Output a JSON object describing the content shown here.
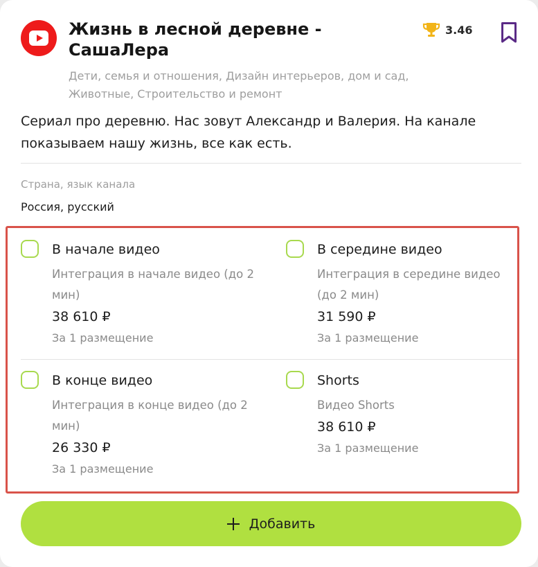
{
  "channel": {
    "platform_icon": "youtube-icon",
    "title": "Жизнь в лесной деревне - СашаЛера",
    "rating": "3.46",
    "rating_icon": "trophy-icon",
    "bookmark_icon": "bookmark-icon",
    "categories": "Дети, семья и отношения, Дизайн интерьеров, дом и сад, Животные, Строительство и ремонт",
    "description": "Сериал про деревню. Нас зовут Александр и Валерия. На канале показываем нашу жизнь, все как есть."
  },
  "meta": {
    "label": "Страна, язык канала",
    "value": "Россия, русский"
  },
  "options": [
    {
      "title": "В начале видео",
      "description": "Интеграция в начале видео (до 2 мин)",
      "price": "38 610 ₽",
      "unit": "За 1 размещение",
      "checked": false
    },
    {
      "title": "В середине видео",
      "description": "Интеграция в середине видео (до 2 мин)",
      "price": "31 590 ₽",
      "unit": "За 1 размещение",
      "checked": false
    },
    {
      "title": "В конце видео",
      "description": "Интеграция в конце видео (до 2 мин)",
      "price": "26 330 ₽",
      "unit": "За 1 размещение",
      "checked": false
    },
    {
      "title": "Shorts",
      "description": "Видео Shorts",
      "price": "38 610 ₽",
      "unit": "За 1 размещение",
      "checked": false
    }
  ],
  "add_button": {
    "icon": "plus-icon",
    "label": "Добавить"
  },
  "colors": {
    "accent_green": "#b0e040",
    "checkbox_border": "#a8d94e",
    "highlight_frame": "#d9534a",
    "youtube_red": "#ee1b1b",
    "bookmark_purple": "#5a2a86",
    "trophy_gold": "#f2b418"
  }
}
